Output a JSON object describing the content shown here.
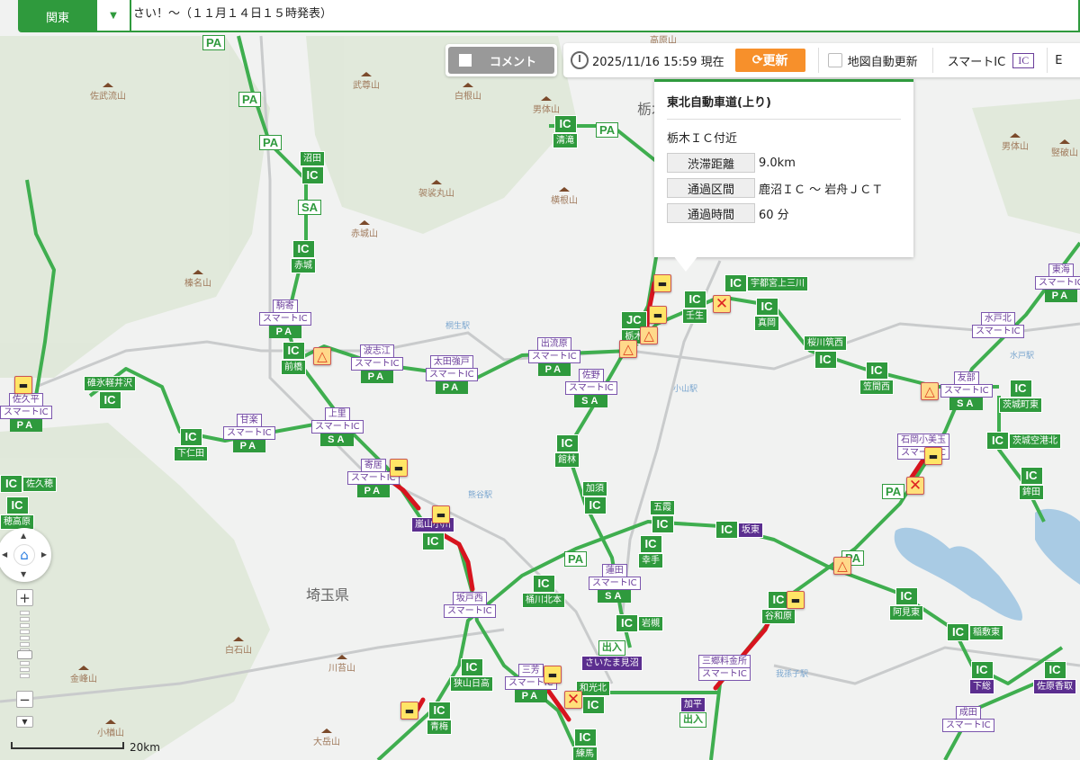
{
  "header": {
    "region_tab": "関東",
    "dropdown_icon": "triangle-down",
    "news_ticker": "さい！～（１１月１４日１５時発表）"
  },
  "toolbar": {
    "comment_label": "コメント",
    "timestamp": "2025/11/16 15:59 現在",
    "update_label": "更新",
    "auto_update_label": "地図自動更新",
    "smart_ic_legend": "スマートIC",
    "smart_ic_badge": "IC",
    "cut_label": "E"
  },
  "popup": {
    "title": "東北自動車道(上り)",
    "location": "栃木ＩＣ付近",
    "rows": [
      {
        "key": "渋滞距離",
        "value": "9.0km"
      },
      {
        "key": "通過区間",
        "value": "鹿沼ＩＣ ～ 岩舟ＪＣＴ"
      },
      {
        "key": "通過時間",
        "value": "60 分"
      }
    ]
  },
  "controls": {
    "home_icon": "home",
    "zoom_in": "+",
    "zoom_out": "−",
    "scale": "20km"
  },
  "map": {
    "ic_label": "IC",
    "ics": [
      "沼田",
      "赤城",
      "前橋",
      "碓氷軽井沢",
      "下仁田",
      "佐久穂",
      "穂高原",
      "清滝",
      "壬生",
      "宇都宮上三川",
      "真岡",
      "桜川筑西",
      "笠間西",
      "茨城町東",
      "茨城空港北",
      "鉾田",
      "館林",
      "加須",
      "五霞",
      "幸手",
      "坂東",
      "桶川北本",
      "岩槻",
      "狭山日高",
      "青梅",
      "嵐山小川",
      "和光北",
      "練馬",
      "谷和原",
      "阿見東",
      "稲敷東",
      "下総",
      "佐原香取"
    ],
    "smart_ics": [
      {
        "name": "駒寄",
        "smart": "スマートIC",
        "area": "PA"
      },
      {
        "name": "波志江",
        "smart": "スマートIC",
        "area": "PA"
      },
      {
        "name": "太田強戸",
        "smart": "スマートIC",
        "area": "PA"
      },
      {
        "name": "出流原",
        "smart": "スマートIC",
        "area": "PA"
      },
      {
        "name": "佐野",
        "smart": "スマートIC",
        "area": "SA"
      },
      {
        "name": "上里",
        "smart": "スマートIC",
        "area": "SA"
      },
      {
        "name": "甘楽",
        "smart": "スマートIC",
        "area": "PA"
      },
      {
        "name": "寄居",
        "smart": "スマートIC",
        "area": "PA"
      },
      {
        "name": "坂戸西",
        "smart": "スマートIC",
        "area": ""
      },
      {
        "name": "蓮田",
        "smart": "スマートIC",
        "area": "SA"
      },
      {
        "name": "三芳",
        "smart": "スマートIC",
        "area": "PA"
      },
      {
        "name": "三郷料金所",
        "smart": "スマートIC",
        "area": ""
      },
      {
        "name": "水戸北",
        "smart": "スマートIC",
        "area": ""
      },
      {
        "name": "友部",
        "smart": "スマートIC",
        "area": "SA"
      },
      {
        "name": "石岡小美玉",
        "smart": "スマートIC",
        "area": ""
      },
      {
        "name": "佐久平",
        "smart": "スマートIC",
        "area": "PA"
      },
      {
        "name": "東海",
        "smart": "スマートIC",
        "area": "PA"
      },
      {
        "name": "成田",
        "smart": "スマートIC",
        "area": ""
      }
    ],
    "facilities": [
      "PA",
      "PA",
      "PA",
      "SA",
      "PA",
      "PA",
      "PA",
      "PA"
    ],
    "junction": {
      "label": "JC",
      "name": "栃木"
    },
    "gates": [
      {
        "name": "さいたま見沼",
        "sub": "出入"
      },
      {
        "name": "加平",
        "sub": "出入"
      }
    ],
    "incidents": [
      "jam",
      "jam",
      "jam",
      "jam",
      "jam",
      "jam",
      "jam",
      "jam",
      "jam",
      "caution",
      "caution",
      "caution",
      "caution",
      "caution",
      "closure",
      "closure",
      "closure"
    ],
    "mountains": [
      "佐武流山",
      "武尊山",
      "白根山",
      "男体山",
      "袈裟丸山",
      "赤城山",
      "横根山",
      "榛名山",
      "男体山",
      "竪破山",
      "白石山",
      "川苔山",
      "金峰山",
      "小楢山",
      "大岳山",
      "高原山"
    ],
    "stations": [
      "桐生駅",
      "小山駅",
      "熊谷駅",
      "水戸駅",
      "我孫子駅"
    ],
    "prefectures": [
      "埼玉県",
      "栃木県"
    ],
    "colors": {
      "expressway": "#3fae4f",
      "congestion": "#d7141e",
      "smart_ic": "#6a3d9a",
      "ic": "#2f9a3d",
      "update": "#f7902b"
    }
  }
}
